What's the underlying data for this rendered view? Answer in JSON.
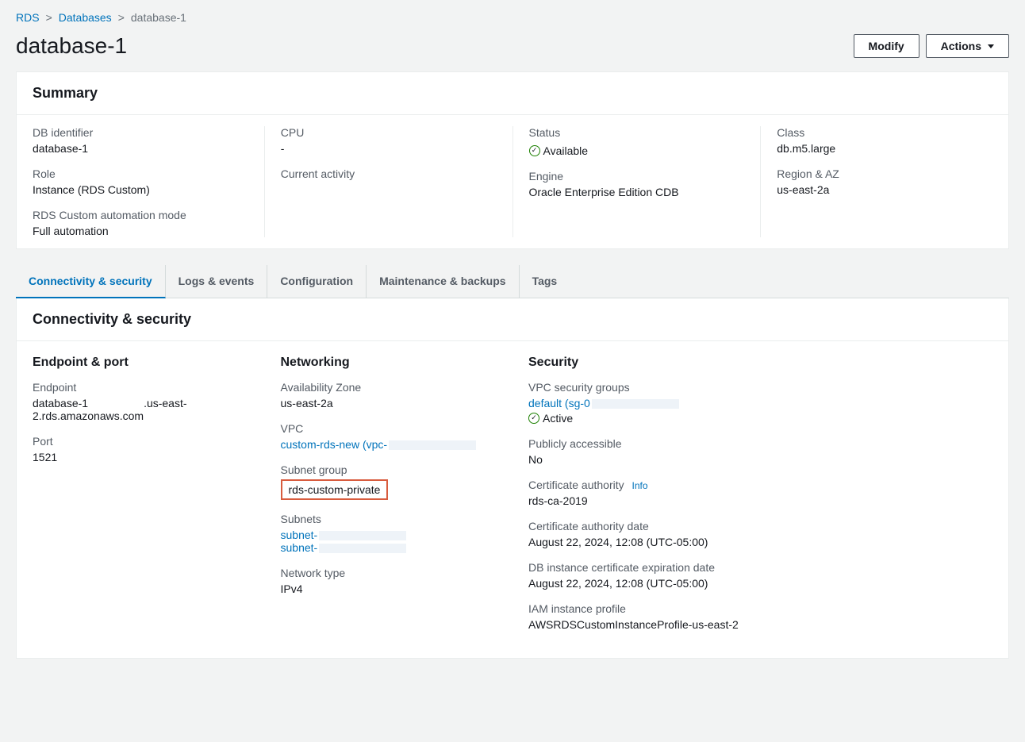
{
  "breadcrumb": {
    "root": "RDS",
    "section": "Databases",
    "current": "database-1"
  },
  "header": {
    "title": "database-1",
    "modify_label": "Modify",
    "actions_label": "Actions"
  },
  "summary": {
    "heading": "Summary",
    "db_identifier_label": "DB identifier",
    "db_identifier": "database-1",
    "role_label": "Role",
    "role": "Instance (RDS Custom)",
    "automation_label": "RDS Custom automation mode",
    "automation": "Full automation",
    "cpu_label": "CPU",
    "cpu": "-",
    "activity_label": "Current activity",
    "activity": "",
    "status_label": "Status",
    "status": "Available",
    "engine_label": "Engine",
    "engine": "Oracle Enterprise Edition CDB",
    "class_label": "Class",
    "class": "db.m5.large",
    "region_label": "Region & AZ",
    "region": "us-east-2a"
  },
  "tabs": {
    "t0": "Connectivity & security",
    "t1": "Logs & events",
    "t2": "Configuration",
    "t3": "Maintenance & backups",
    "t4": "Tags"
  },
  "connectivity": {
    "heading": "Connectivity & security",
    "endpoint_port_heading": "Endpoint & port",
    "endpoint_label": "Endpoint",
    "endpoint_prefix": "database-1",
    "endpoint_suffix": ".us-east-2.rds.amazonaws.com",
    "port_label": "Port",
    "port": "1521",
    "networking_heading": "Networking",
    "az_label": "Availability Zone",
    "az": "us-east-2a",
    "vpc_label": "VPC",
    "vpc_link": "custom-rds-new (vpc-",
    "subnet_group_label": "Subnet group",
    "subnet_group": "rds-custom-private",
    "subnets_label": "Subnets",
    "subnet1": "subnet-",
    "subnet2": "subnet-",
    "network_type_label": "Network type",
    "network_type": "IPv4",
    "security_heading": "Security",
    "sg_label": "VPC security groups",
    "sg_link": "default (sg-0",
    "sg_status": "Active",
    "public_label": "Publicly accessible",
    "public": "No",
    "ca_label": "Certificate authority",
    "ca_info": "Info",
    "ca": "rds-ca-2019",
    "ca_date_label": "Certificate authority date",
    "ca_date": "August 22, 2024, 12:08 (UTC-05:00)",
    "cert_exp_label": "DB instance certificate expiration date",
    "cert_exp": "August 22, 2024, 12:08 (UTC-05:00)",
    "iam_label": "IAM instance profile",
    "iam": "AWSRDSCustomInstanceProfile-us-east-2"
  }
}
